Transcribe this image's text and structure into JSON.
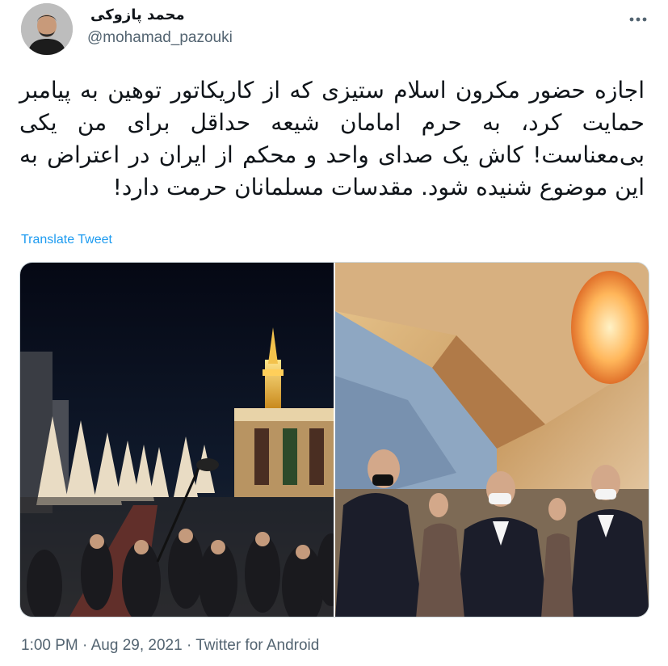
{
  "author": {
    "name": "محمد پازوکی",
    "handle": "@mohamad_pazouki"
  },
  "tweet": {
    "text": "اجازه حضور مکرون اسلام ستیزی که از کاریکاتور توهین به پیامبر حمایت کرد، به حرم امامان شیعه حداقل برای من یکی بی‌معناست! کاش یک صدای واحد و محکم از ایران در اعتراض به این موضوع شنیده شود. مقدسات مسلمانان حرمت دارد!",
    "translate_label": "Translate Tweet"
  },
  "footer": {
    "time": "1:00 PM",
    "separator": "·",
    "date": "Aug 29, 2021",
    "source": "Twitter for Android"
  },
  "icons": {
    "more": "more-horizontal-icon"
  },
  "colors": {
    "text": "#0f1419",
    "secondary": "#536471",
    "link": "#1d9bf0",
    "border": "#cfd9de"
  }
}
